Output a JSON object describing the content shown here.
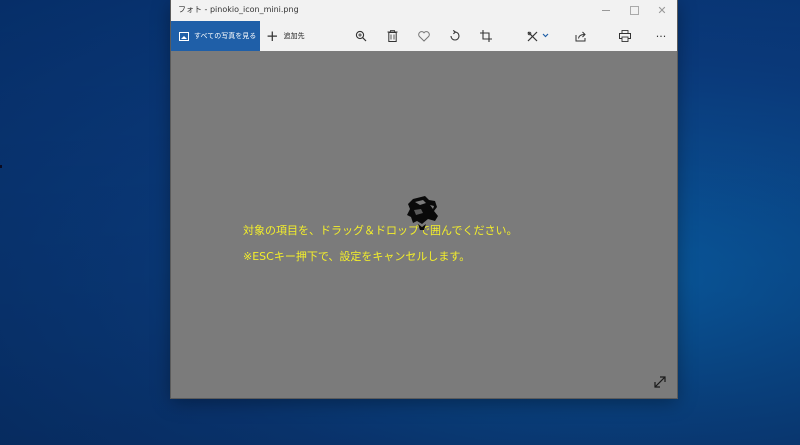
{
  "window": {
    "title": "フォト - pinokio_icon_mini.png"
  },
  "titlebar": {
    "minimize_glyph": "—",
    "maximize_glyph": "□",
    "close_glyph": "✕"
  },
  "toolbar": {
    "all_photos_label": "すべての写真を見る",
    "add_label": "追加先",
    "icons": [
      "zoom-icon",
      "delete-icon",
      "favorite-icon",
      "rotate-icon",
      "crop-icon",
      "edit-icon",
      "share-icon",
      "print-icon",
      "more-icon"
    ],
    "more_glyph": "···"
  },
  "viewer": {
    "message_line1": "対象の項目を、ドラッグ＆ドロップで囲んでください。",
    "message_line2": "※ESCキー押下で、設定をキャンセルします。"
  },
  "colors": {
    "accent": "#1f5fa8",
    "message_text": "#f4ef2a",
    "viewer_bg": "#7b7b7b",
    "desktop_bg": "#0a4a8f"
  }
}
